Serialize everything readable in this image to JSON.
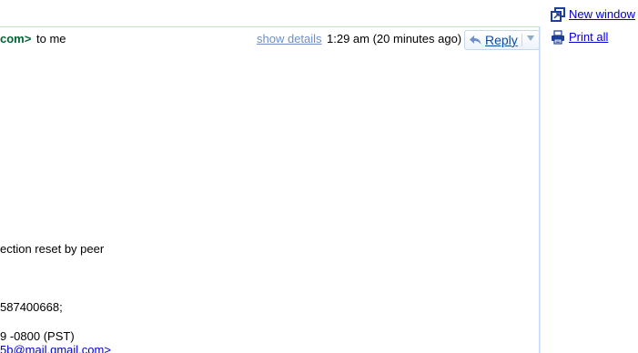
{
  "header": {
    "sender_fragment": "com>",
    "recipient": "to me",
    "show_details": "show details",
    "timestamp": "1:29 am (20 minutes ago)",
    "reply_label": "Reply"
  },
  "side_actions": {
    "new_window": "New window",
    "print_all": "Print all"
  },
  "body_lines": [
    "ection reset by peer",
    "587400668;",
    "9 -0800 (PST)",
    "5b@mail.gmail.com>"
  ],
  "colors": {
    "sender": "#006633",
    "link": "#0000cc",
    "show_details": "#6e8fc5",
    "card_border": "#c3d9ff"
  },
  "icons": {
    "reply": "reply-arrow-icon",
    "reply_more": "chevron-down-icon",
    "new_window": "new-window-icon",
    "print": "printer-icon"
  }
}
